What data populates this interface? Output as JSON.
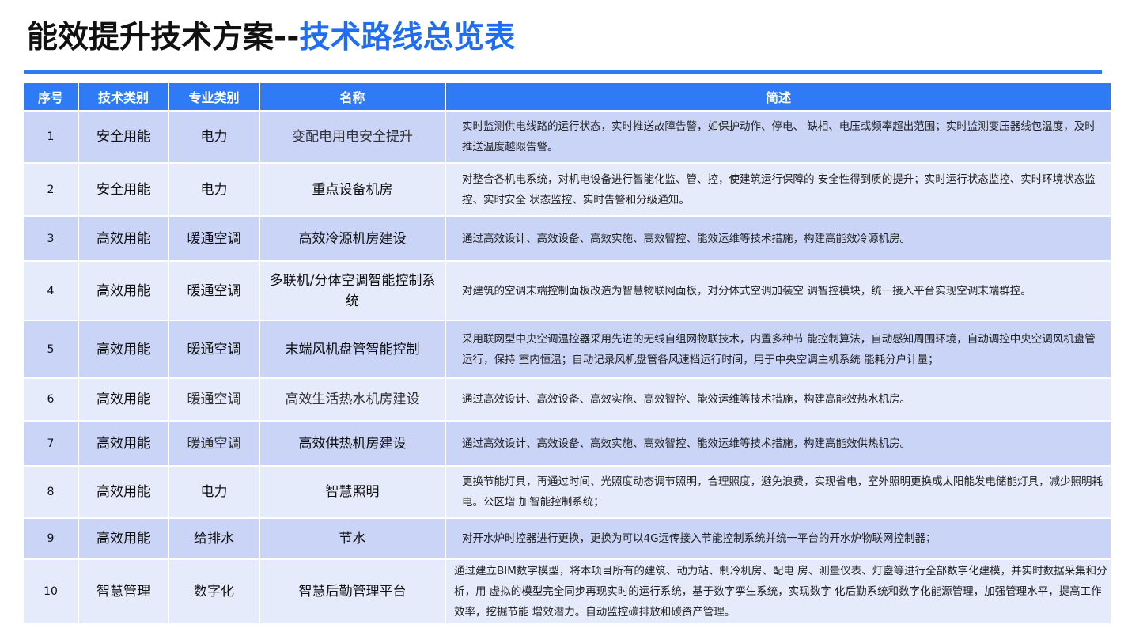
{
  "header": {
    "title_main": "能效提升技术方案",
    "title_sep": "--",
    "title_sub": "技术路线总览表"
  },
  "colors": {
    "accent": "#2f7bf5",
    "row_odd": "#c9d4f7",
    "row_even": "#e6ebfb"
  },
  "table": {
    "columns": [
      "序号",
      "技术类别",
      "专业类别",
      "名称",
      "简述"
    ],
    "rows": [
      {
        "no": "1",
        "tech": "安全用能",
        "major": "电力",
        "name": "变配电用电安全提升",
        "desc": "实时监测供电线路的运行状态，实时推送故障告警，如保护动作、停电、  缺相、电压或频率超出范围；实时监测变压器线包温度，及时推送温度越限告警。"
      },
      {
        "no": "2",
        "tech": "安全用能",
        "major": "电力",
        "name": "重点设备机房",
        "desc": "对整合各机电系统，对机电设备进行智能化监、管、控，使建筑运行保障的  安全性得到质的提升；实时运行状态监控、实时环境状态监控、实时安全  状态监控、实时告警和分级通知。"
      },
      {
        "no": "3",
        "tech": "高效用能",
        "major": "暖通空调",
        "name": "高效冷源机房建设",
        "desc": "通过高效设计、高效设备、高效实施、高效智控、能效运维等技术措施，构建高能效冷源机房。"
      },
      {
        "no": "4",
        "tech": "高效用能",
        "major": "暖通空调",
        "name": "多联机/分体空调智能控制系统",
        "desc": "对建筑的空调末端控制面板改造为智慧物联网面板，对分体式空调加装空  调智控模块，统一接入平台实现空调末端群控。"
      },
      {
        "no": "5",
        "tech": "高效用能",
        "major": "暖通空调",
        "name": "末端风机盘管智能控制",
        "desc": "采用联网型中央空调温控器采用先进的无线自组网物联技术，内置多种节  能控制算法，自动感知周围环境，自动调控中央空调风机盘管运行，保持  室内恒温；自动记录风机盘管各风速档运行时间，用于中央空调主机系统  能耗分户计量；"
      },
      {
        "no": "6",
        "tech": "高效用能",
        "major": "暖通空调",
        "name": "高效生活热水机房建设",
        "desc": "通过高效设计、高效设备、高效实施、高效智控、能效运维等技术措施，构建高能效热水机房。"
      },
      {
        "no": "7",
        "tech": "高效用能",
        "major": "暖通空调",
        "name": "高效供热机房建设",
        "desc": "通过高效设计、高效设备、高效实施、高效智控、能效运维等技术措施，构建高能效供热机房。"
      },
      {
        "no": "8",
        "tech": "高效用能",
        "major": "电力",
        "name": "智慧照明",
        "desc": "更换节能灯具，再通过时间、光照度动态调节照明，合理照度，避免浪费，实现省电，室外照明更换成太阳能发电储能灯具，减少照明耗电。公区增  加智能控制系统；"
      },
      {
        "no": "9",
        "tech": "高效用能",
        "major": "给排水",
        "name": "节水",
        "desc": "对开水炉时控器进行更换，更换为可以4G远传接入节能控制系统并统一平台的开水炉物联网控制器；"
      },
      {
        "no": "10",
        "tech": "智慧管理",
        "major": "数字化",
        "name": "智慧后勤管理平台",
        "desc": "通过建立BIM数字模型，将本项目所有的建筑、动力站、制冷机房、配电  房、测量仪表、灯盏等进行全部数字化建模，并实时数据采集和分析，用  虚拟的模型完全同步再现实时的运行系统，基于数字孪生系统，实现数字  化后勤系统和数字化能源管理，加强管理水平，提高工作效率，挖掘节能  增效潜力。自动监控碳排放和碳资产管理。"
      }
    ]
  }
}
